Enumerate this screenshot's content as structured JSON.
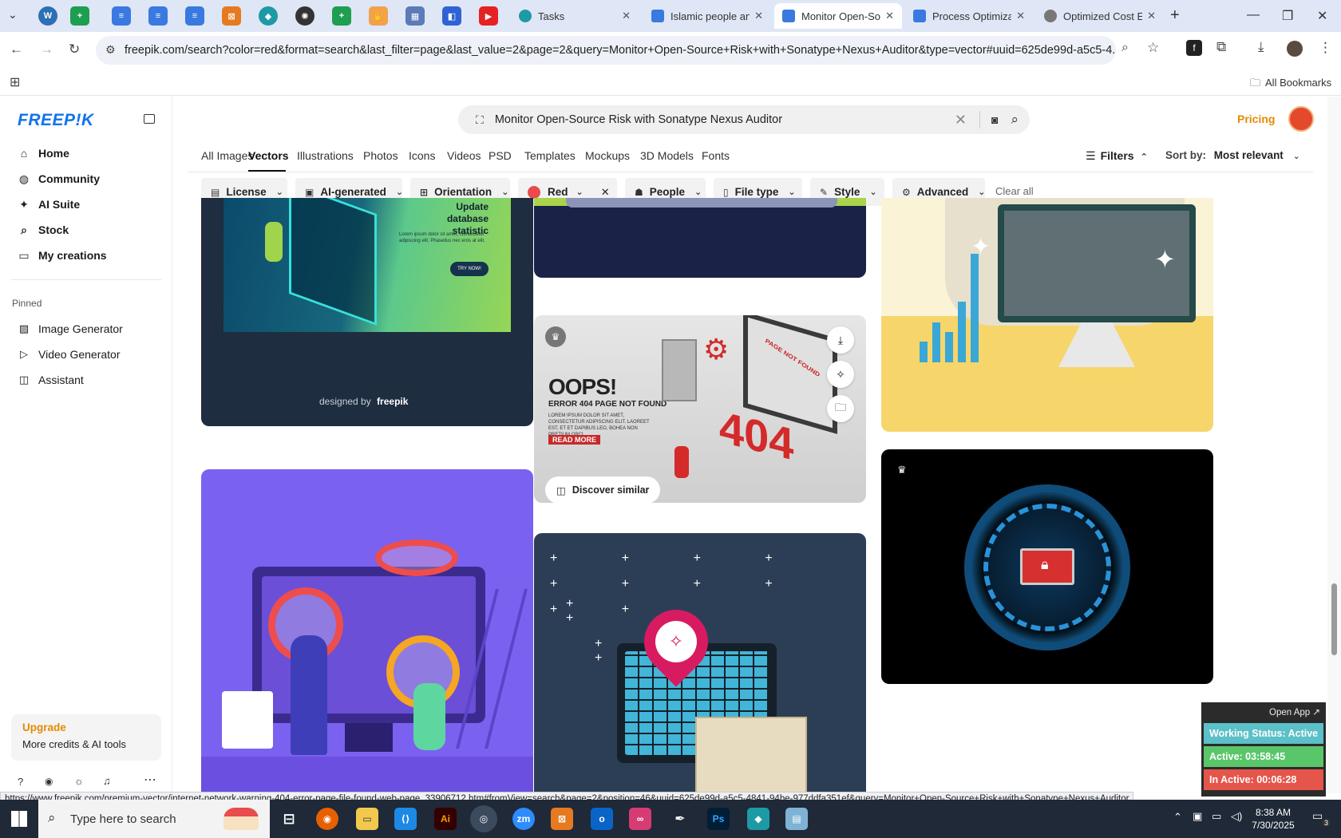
{
  "browser": {
    "tabs": [
      {
        "title": "Tasks",
        "active": false
      },
      {
        "title": "Islamic people an",
        "active": false
      },
      {
        "title": "Monitor Open-So",
        "active": true
      },
      {
        "title": "Process Optimiza",
        "active": false
      },
      {
        "title": "Optimized Cost E",
        "active": false
      }
    ],
    "url": "freepik.com/search?color=red&format=search&last_filter=page&last_value=2&page=2&query=Monitor+Open-Source+Risk+with+Sonatype+Nexus+Auditor&type=vector#uuid=625de99d-a5c5-4...",
    "all_bookmarks": "All Bookmarks",
    "status_url": "https://www.freepik.com/premium-vector/internet-network-warning-404-error-page-file-found-web-page_33906712.htm#fromView=search&page=2&position=46&uuid=625de99d-a5c5-4841-94be-977ddfa351ef&query=Monitor+Open-Source+Risk+with+Sonatype+Nexus+Auditor"
  },
  "sidebar": {
    "logo": "FREEP!K",
    "nav": [
      {
        "label": "Home",
        "icon": "home-icon"
      },
      {
        "label": "Community",
        "icon": "globe-icon"
      },
      {
        "label": "AI Suite",
        "icon": "sparkle-icon"
      },
      {
        "label": "Stock",
        "icon": "search-icon"
      },
      {
        "label": "My creations",
        "icon": "folder-icon"
      }
    ],
    "pinned_label": "Pinned",
    "pinned": [
      {
        "label": "Image Generator",
        "icon": "image-icon"
      },
      {
        "label": "Video Generator",
        "icon": "video-icon"
      },
      {
        "label": "Assistant",
        "icon": "chat-icon"
      }
    ],
    "upgrade_title": "Upgrade",
    "upgrade_sub": "More credits & AI tools"
  },
  "header": {
    "search_query": "Monitor Open-Source Risk with Sonatype Nexus Auditor",
    "pricing": "Pricing"
  },
  "categories": [
    "All Images",
    "Vectors",
    "Illustrations",
    "Photos",
    "Icons",
    "Videos",
    "PSD",
    "Templates",
    "Mockups",
    "3D Models",
    "Fonts"
  ],
  "active_category": "Vectors",
  "filters_label": "Filters",
  "sort_label": "Sort by:",
  "sort_value": "Most relevant",
  "chips": [
    "License",
    "AI-generated",
    "Orientation",
    "Red",
    "People",
    "File type",
    "Style",
    "Advanced"
  ],
  "clear_all": "Clear all",
  "cards": {
    "card1_title": "Update database statistic",
    "card1_body": "Lorem ipsum dolor sit amet, consectetur adipiscing elit. Phasellus nec eros at elit.",
    "card1_btn": "TRY NOW!",
    "card1_credit": "designed by",
    "card1_brand": "freepik",
    "error_title": "OOPS!",
    "error_sub": "ERROR 404 PAGE NOT FOUND",
    "error_body": "LOREM IPSUM DOLOR SIT AMET, CONSECTETUR ADIPISCING ELIT. LAOREET EST, ET ET DAPIBUS LEO, BOHEA NON PRETIUM ORCI.",
    "error_btn": "READ MORE",
    "error_sign": "PAGE NOT FOUND",
    "error_number": "404",
    "discover": "Discover similar"
  },
  "tracker": {
    "open_app": "Open App ↗",
    "status": "Working Status: Active",
    "active": "Active: 03:58:45",
    "inactive": "In Active: 00:06:28"
  },
  "taskbar": {
    "search_placeholder": "Type here to search",
    "time": "8:38 AM",
    "date": "7/30/2025",
    "notif_count": "3"
  },
  "colors": {
    "accent": "#1273eb",
    "pricing": "#e58a00",
    "upgrade": "#e58a00",
    "red_chip": "#e94a4a"
  }
}
